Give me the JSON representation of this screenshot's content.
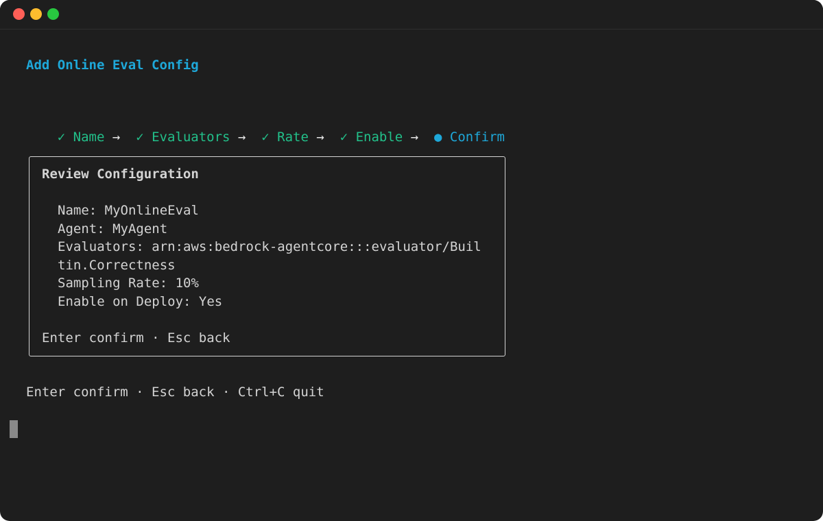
{
  "colors": {
    "window_bg": "#1e1e1e",
    "text": "#d4d4d4",
    "title": "#1ea8d9",
    "done_step": "#22c08a",
    "active_step": "#1ea8d9",
    "arrow": "#e8e8e8",
    "cursor": "#8a8a8a",
    "traffic_red": "#ff5f57",
    "traffic_yellow": "#febc2e",
    "traffic_green": "#28c840"
  },
  "title": "Add Online Eval Config",
  "steps": [
    {
      "label": "✓ Name",
      "state": "done"
    },
    {
      "label": "✓ Evaluators",
      "state": "done"
    },
    {
      "label": "✓ Rate",
      "state": "done"
    },
    {
      "label": "✓ Enable",
      "state": "done"
    },
    {
      "label": "● Confirm",
      "state": "active"
    }
  ],
  "arrow": "→",
  "review": {
    "heading": "Review Configuration",
    "name_line": "Name: MyOnlineEval",
    "agent_line": "Agent: MyAgent",
    "evaluators_line_1": "Evaluators: arn:aws:bedrock-agentcore:::evaluator/Buil",
    "evaluators_line_2": "tin.Correctness",
    "rate_line": "Sampling Rate: 10%",
    "deploy_line": "Enable on Deploy: Yes",
    "hint": "Enter confirm · Esc back"
  },
  "footer_hint": "Enter confirm · Esc back · Ctrl+C quit"
}
